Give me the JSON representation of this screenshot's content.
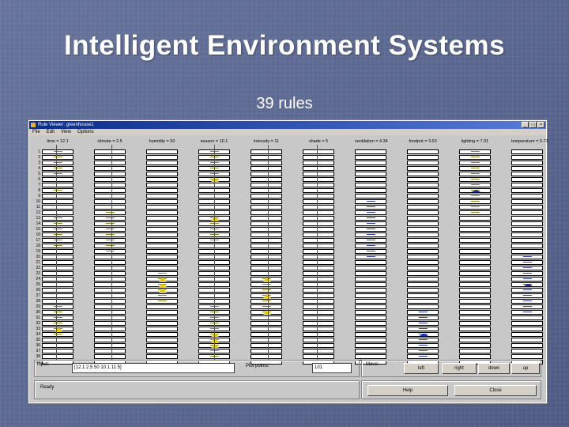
{
  "slide": {
    "title": "Intelligent  Environment Systems",
    "subtitle": "39 rules"
  },
  "window": {
    "title": "Rule Viewer: greenhouse1",
    "controls": [
      "_",
      "□",
      "×"
    ],
    "menu": [
      "File",
      "Edit",
      "View",
      "Options"
    ]
  },
  "columns": [
    {
      "label": "time = 12.1",
      "type": "input"
    },
    {
      "label": "climate = 2.5",
      "type": "input"
    },
    {
      "label": "humidity = 50",
      "type": "input"
    },
    {
      "label": "season = 10.1",
      "type": "input"
    },
    {
      "label": "intensity = 11",
      "type": "input"
    },
    {
      "label": "shade = 5",
      "type": "input"
    },
    {
      "label": "ventilation = 4.34",
      "type": "output"
    },
    {
      "label": "foodpot = 3.53",
      "type": "output"
    },
    {
      "label": "lighting = 7.01",
      "type": "output"
    },
    {
      "label": "temperature = 5.73",
      "type": "output"
    }
  ],
  "rule_count": 39,
  "bottom": {
    "input_label": "Input:",
    "input_value": "[12.1 2.5 50 10.1 11 5]",
    "plot_points_label": "Plot points:",
    "plot_points_value": "101",
    "move_label": "Move:",
    "move_buttons": [
      "left",
      "right",
      "down",
      "up"
    ],
    "ready_label": "Ready",
    "help_label": "Help",
    "close_label": "Close"
  },
  "colors": {
    "background": "#5b6790",
    "titlebar": "#0a2a8c",
    "indicator_line": "#d02020",
    "mf_yellow": "#e8c800",
    "mf_blue": "#2030a0"
  }
}
